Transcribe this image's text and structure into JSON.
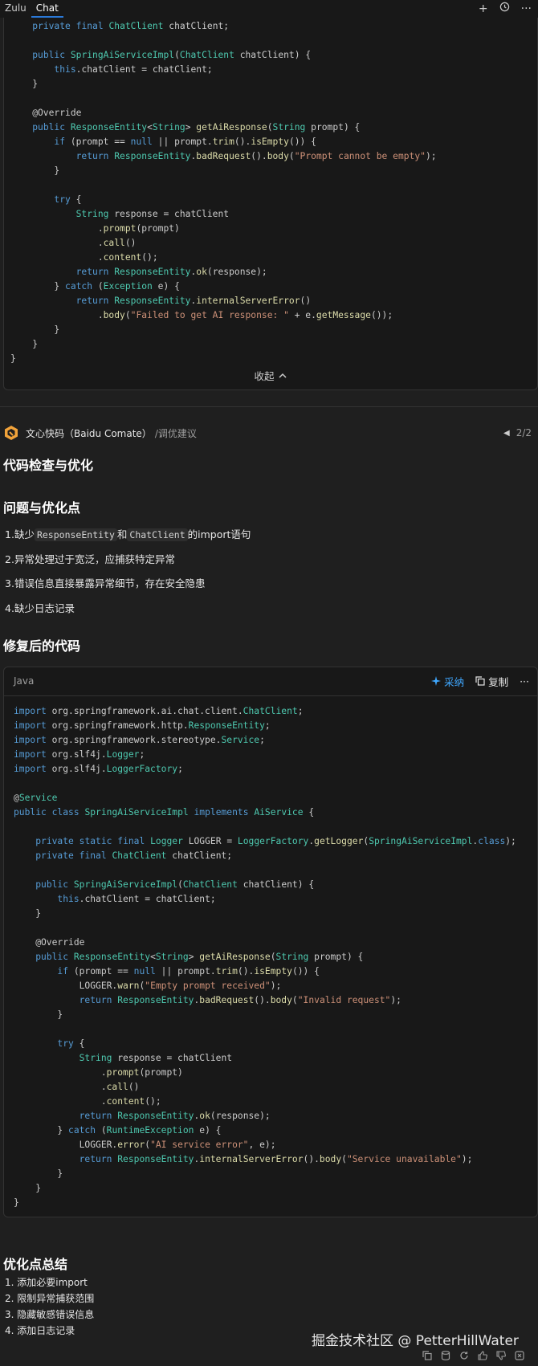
{
  "topbar": {
    "tabs": [
      "Zulu",
      "Chat"
    ],
    "icons": [
      "plus-icon",
      "history-icon",
      "more-icon"
    ]
  },
  "code_block_1": {
    "lines": [
      "    private final ChatClient chatClient;",
      "",
      "    public SpringAiServiceImpl(ChatClient chatClient) {",
      "        this.chatClient = chatClient;",
      "    }",
      "",
      "    @Override",
      "    public ResponseEntity<String> getAiResponse(String prompt) {",
      "        if (prompt == null || prompt.trim().isEmpty()) {",
      "            return ResponseEntity.badRequest().body(\"Prompt cannot be empty\");",
      "        }",
      "",
      "        try {",
      "            String response = chatClient",
      "                .prompt(prompt)",
      "                .call()",
      "                .content();",
      "            return ResponseEntity.ok(response);",
      "        } catch (Exception e) {",
      "            return ResponseEntity.internalServerError()",
      "                .body(\"Failed to get AI response: \" + e.getMessage());",
      "        }",
      "    }",
      "}"
    ],
    "collapse_label": "收起"
  },
  "agent": {
    "name": "文心快码（Baidu Comate）",
    "command": "/调优建议",
    "pager": "2/2"
  },
  "answer": {
    "title": "代码检查与优化",
    "issues_heading": "问题与优化点",
    "issues": [
      {
        "n": "1.",
        "pre": "缺少",
        "code1": "ResponseEntity",
        "mid": "和",
        "code2": "ChatClient",
        "post": "的import语句"
      },
      {
        "n": "2.",
        "text": "异常处理过于宽泛，应捕获特定异常"
      },
      {
        "n": "3.",
        "text": "错误信息直接暴露异常细节，存在安全隐患"
      },
      {
        "n": "4.",
        "text": "缺少日志记录"
      }
    ],
    "fixed_heading": "修复后的代码"
  },
  "code_block_2": {
    "language": "Java",
    "adopt_label": "采纳",
    "copy_label": "复制",
    "lines": [
      "import org.springframework.ai.chat.client.ChatClient;",
      "import org.springframework.http.ResponseEntity;",
      "import org.springframework.stereotype.Service;",
      "import org.slf4j.Logger;",
      "import org.slf4j.LoggerFactory;",
      "",
      "@Service",
      "public class SpringAiServiceImpl implements AiService {",
      "",
      "    private static final Logger LOGGER = LoggerFactory.getLogger(SpringAiServiceImpl.class);",
      "    private final ChatClient chatClient;",
      "",
      "    public SpringAiServiceImpl(ChatClient chatClient) {",
      "        this.chatClient = chatClient;",
      "    }",
      "",
      "    @Override",
      "    public ResponseEntity<String> getAiResponse(String prompt) {",
      "        if (prompt == null || prompt.trim().isEmpty()) {",
      "            LOGGER.warn(\"Empty prompt received\");",
      "            return ResponseEntity.badRequest().body(\"Invalid request\");",
      "        }",
      "",
      "        try {",
      "            String response = chatClient",
      "                .prompt(prompt)",
      "                .call()",
      "                .content();",
      "            return ResponseEntity.ok(response);",
      "        } catch (RuntimeException e) {",
      "            LOGGER.error(\"AI service error\", e);",
      "            return ResponseEntity.internalServerError().body(\"Service unavailable\");",
      "        }",
      "    }",
      "}"
    ]
  },
  "summary": {
    "heading": "优化点总结",
    "items": [
      "1. 添加必要import",
      "2. 限制异常捕获范围",
      "3. 隐藏敏感错误信息",
      "4. 添加日志记录"
    ]
  },
  "watermark": "掘金技术社区 @ PetterHillWater",
  "colors": {
    "accent": "#3fa7ff",
    "background": "#1f1f1f",
    "code_bg": "#181818"
  }
}
